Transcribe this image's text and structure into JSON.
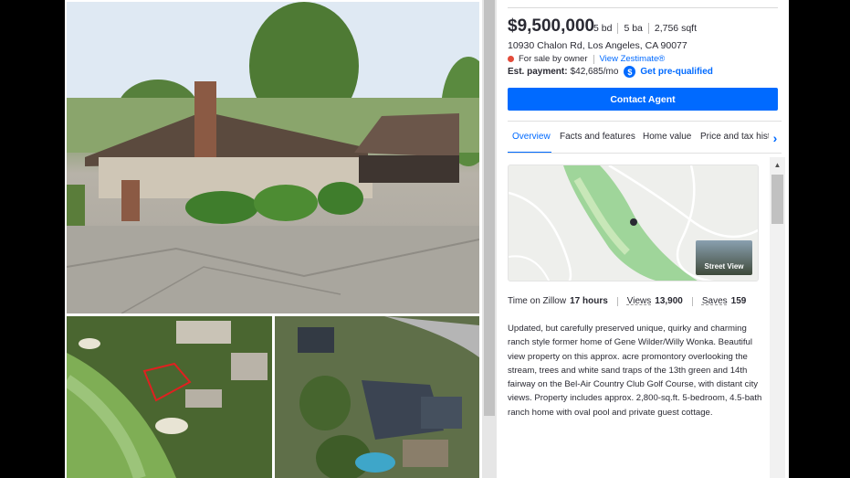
{
  "listing": {
    "price": "$9,500,000",
    "beds": "5 bd",
    "baths": "5 ba",
    "sqft": "2,756 sqft",
    "address": "10930 Chalon Rd, Los Angeles, CA 90077",
    "status": "For sale by owner",
    "zestimate_link": "View Zestimate®",
    "est_payment_label": "Est. payment:",
    "est_payment_value": "$42,685/mo",
    "prequal_link": "Get pre-qualified",
    "contact_button": "Contact Agent"
  },
  "tabs": [
    {
      "label": "Overview",
      "active": true
    },
    {
      "label": "Facts and features",
      "active": false
    },
    {
      "label": "Home value",
      "active": false
    },
    {
      "label": "Price and tax history",
      "active": false
    }
  ],
  "map": {
    "street_view_label": "Street View"
  },
  "stats": {
    "time_label": "Time on Zillow",
    "time_value": "17 hours",
    "views_label": "Views",
    "views_value": "13,900",
    "saves_label": "Saves",
    "saves_value": "159"
  },
  "description": "Updated, but carefully preserved unique, quirky and charming ranch style former home of Gene Wilder/Willy Wonka. Beautiful view property on this approx. acre promontory overlooking the stream, trees and white sand traps of the 13th green and 14th fairway on the Bel-Air Country Club Golf Course, with distant city views. Property includes approx. 2,800-sq.ft. 5-bedroom, 4.5-bath ranch home with oval pool and private guest cottage.",
  "icons": {
    "status": "status-dot-icon",
    "prequal": "dollar-icon",
    "tabs_next": "chevron-right-icon",
    "scroll_up": "arrow-up-icon"
  },
  "colors": {
    "accent": "#006aff",
    "status_dot": "#e34b3a"
  }
}
